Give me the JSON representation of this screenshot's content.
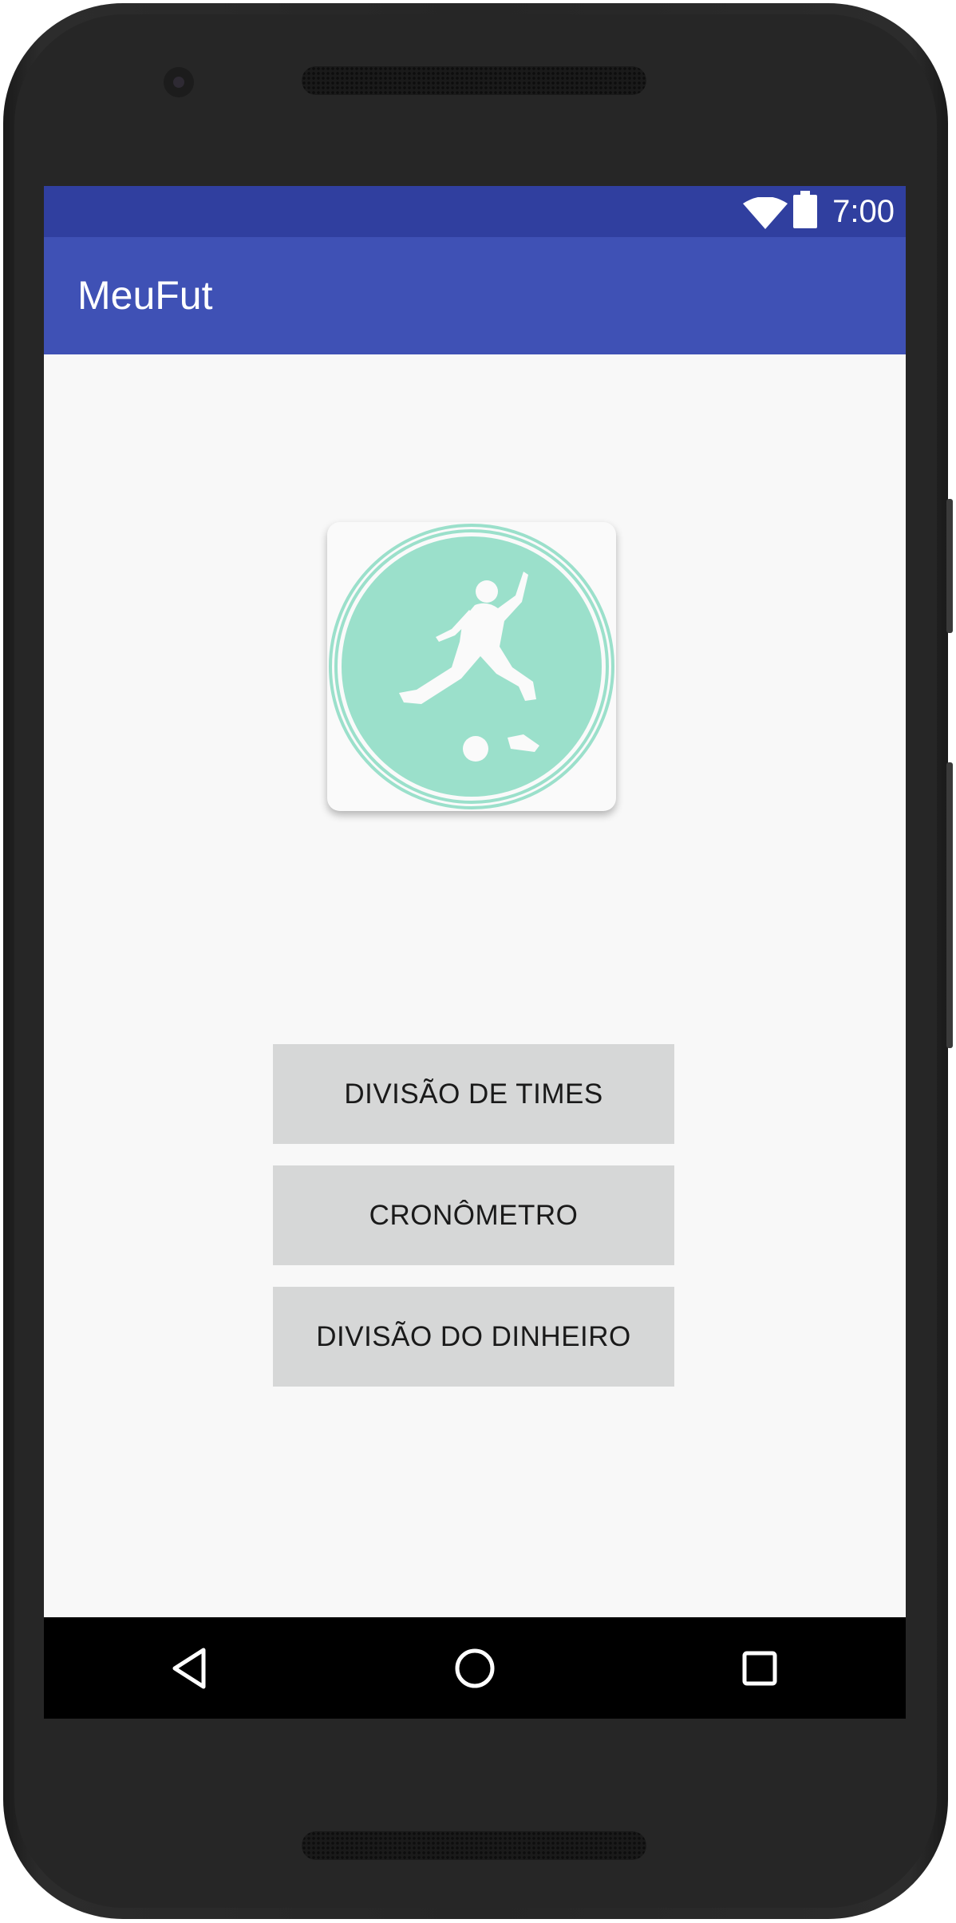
{
  "status_bar": {
    "time": "7:00",
    "wifi_icon": "wifi-icon",
    "battery_icon": "battery-icon"
  },
  "app_bar": {
    "title": "MeuFut"
  },
  "logo": {
    "icon": "soccer-player-icon",
    "color": "#9be0cb"
  },
  "buttons": [
    {
      "label": "DIVISÃO DE TIMES"
    },
    {
      "label": "CRONÔMETRO"
    },
    {
      "label": "DIVISÃO DO DINHEIRO"
    }
  ],
  "nav_bar": {
    "back_icon": "back-icon",
    "home_icon": "home-icon",
    "recents_icon": "recents-icon"
  },
  "colors": {
    "status_bar": "#303f9f",
    "app_bar": "#3f51b5",
    "background": "#f8f8f8",
    "button": "#d6d7d7"
  }
}
